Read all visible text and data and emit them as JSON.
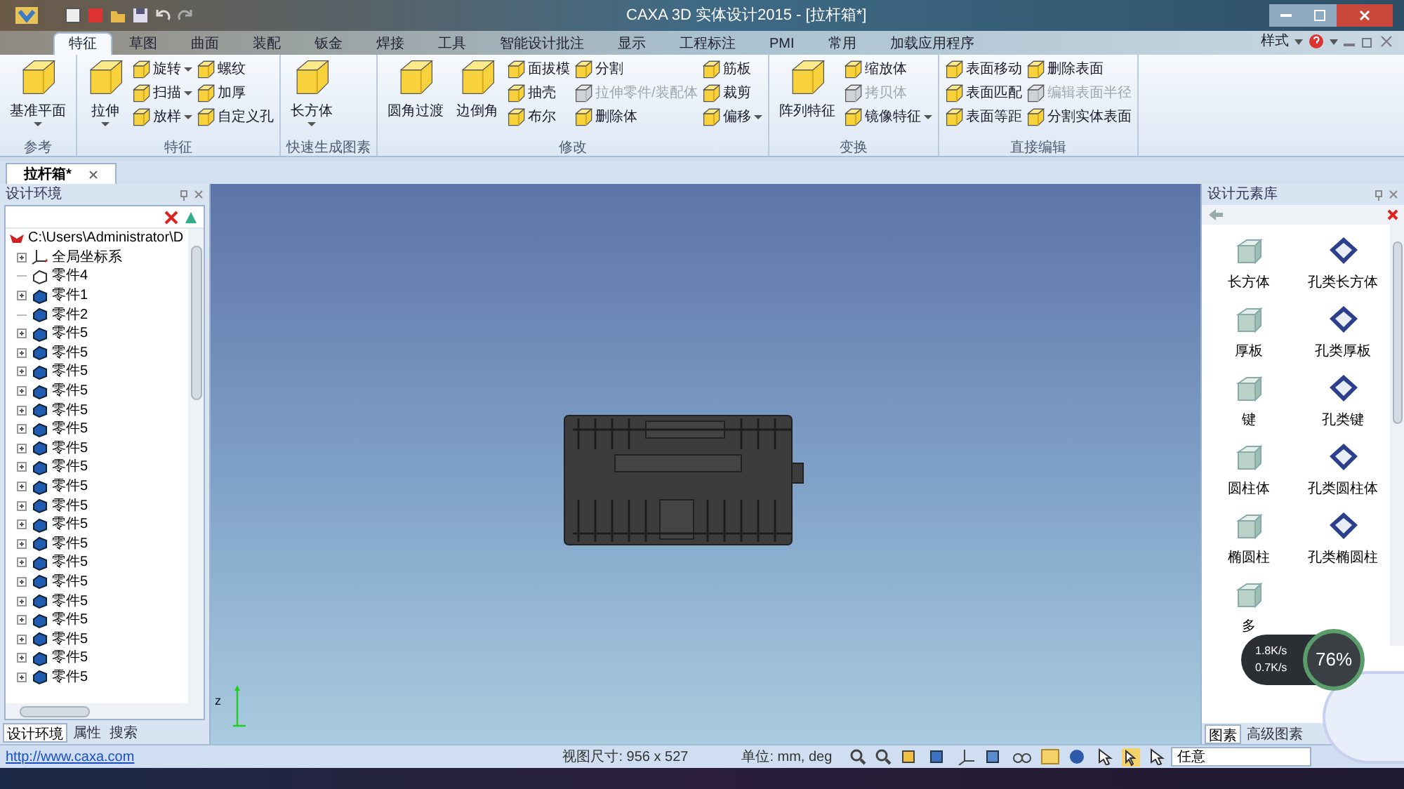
{
  "window": {
    "title": "CAXA 3D 实体设计2015 - [拉杆箱*]"
  },
  "ribbon_tabs": [
    {
      "label": "特征",
      "selected": true
    },
    {
      "label": "草图",
      "selected": false
    },
    {
      "label": "曲面",
      "selected": false
    },
    {
      "label": "装配",
      "selected": false
    },
    {
      "label": "钣金",
      "selected": false
    },
    {
      "label": "焊接",
      "selected": false
    },
    {
      "label": "工具",
      "selected": false
    },
    {
      "label": "智能设计批注",
      "selected": false
    },
    {
      "label": "显示",
      "selected": false
    },
    {
      "label": "工程标注",
      "selected": false
    },
    {
      "label": "PMI",
      "selected": false
    },
    {
      "label": "常用",
      "selected": false
    },
    {
      "label": "加载应用程序",
      "selected": false
    }
  ],
  "style_menu": "样式",
  "ribbon_groups": [
    {
      "label": "参考",
      "items": [
        {
          "label": "基准平面",
          "kind": "large",
          "dropdown": true,
          "disabled": false
        }
      ]
    },
    {
      "label": "特征",
      "items": [
        {
          "label": "拉伸",
          "kind": "large",
          "dropdown": true,
          "disabled": false
        },
        {
          "label": "旋转",
          "kind": "small",
          "dropdown": true,
          "disabled": false
        },
        {
          "label": "扫描",
          "kind": "small",
          "dropdown": true,
          "disabled": false
        },
        {
          "label": "放样",
          "kind": "small",
          "dropdown": true,
          "disabled": false
        },
        {
          "label": "螺纹",
          "kind": "small",
          "dropdown": false,
          "disabled": false
        },
        {
          "label": "加厚",
          "kind": "small",
          "dropdown": false,
          "disabled": false
        },
        {
          "label": "自定义孔",
          "kind": "small",
          "dropdown": false,
          "disabled": false
        }
      ]
    },
    {
      "label": "快速生成图素",
      "items": [
        {
          "label": "长方体",
          "kind": "large",
          "dropdown": true,
          "disabled": false
        }
      ]
    },
    {
      "label": "修改",
      "items": [
        {
          "label": "圆角过渡",
          "kind": "large",
          "dropdown": false,
          "disabled": false
        },
        {
          "label": "边倒角",
          "kind": "large",
          "dropdown": false,
          "disabled": false
        },
        {
          "label": "面拔模",
          "kind": "small",
          "dropdown": false,
          "disabled": false
        },
        {
          "label": "抽壳",
          "kind": "small",
          "dropdown": false,
          "disabled": false
        },
        {
          "label": "布尔",
          "kind": "small",
          "dropdown": false,
          "disabled": false
        },
        {
          "label": "分割",
          "kind": "small",
          "dropdown": false,
          "disabled": false
        },
        {
          "label": "拉伸零件/装配体",
          "kind": "small",
          "dropdown": false,
          "disabled": true
        },
        {
          "label": "删除体",
          "kind": "small",
          "dropdown": false,
          "disabled": false
        },
        {
          "label": "筋板",
          "kind": "small",
          "dropdown": false,
          "disabled": false
        },
        {
          "label": "裁剪",
          "kind": "small",
          "dropdown": false,
          "disabled": false
        },
        {
          "label": "偏移",
          "kind": "small",
          "dropdown": true,
          "disabled": false
        }
      ]
    },
    {
      "label": "变换",
      "items": [
        {
          "label": "阵列特征",
          "kind": "large",
          "dropdown": false,
          "disabled": false
        },
        {
          "label": "缩放体",
          "kind": "small",
          "dropdown": false,
          "disabled": false
        },
        {
          "label": "拷贝体",
          "kind": "small",
          "dropdown": false,
          "disabled": true
        },
        {
          "label": "镜像特征",
          "kind": "small",
          "dropdown": true,
          "disabled": false
        }
      ]
    },
    {
      "label": "直接编辑",
      "items": [
        {
          "label": "表面移动",
          "kind": "small",
          "dropdown": false,
          "disabled": false
        },
        {
          "label": "表面匹配",
          "kind": "small",
          "dropdown": false,
          "disabled": false
        },
        {
          "label": "表面等距",
          "kind": "small",
          "dropdown": false,
          "disabled": false
        },
        {
          "label": "删除表面",
          "kind": "small",
          "dropdown": false,
          "disabled": false
        },
        {
          "label": "编辑表面半径",
          "kind": "small",
          "dropdown": false,
          "disabled": true
        },
        {
          "label": "分割实体表面",
          "kind": "small",
          "dropdown": false,
          "disabled": false
        }
      ]
    }
  ],
  "document_tab": "拉杆箱*",
  "left_panel": {
    "title": "设计环境",
    "tree": {
      "label": "C:\\Users\\Administrator\\D",
      "children": [
        {
          "label": "全局坐标系",
          "kind": "axes",
          "expander": true
        },
        {
          "label": "零件4",
          "kind": "part_outline",
          "expander": false
        },
        {
          "label": "零件1",
          "kind": "part",
          "expander": true
        },
        {
          "label": "零件2",
          "kind": "part",
          "expander": false
        },
        {
          "label": "零件5",
          "kind": "part",
          "expander": true
        },
        {
          "label": "零件5",
          "kind": "part",
          "expander": true
        },
        {
          "label": "零件5",
          "kind": "part",
          "expander": true
        },
        {
          "label": "零件5",
          "kind": "part",
          "expander": true
        },
        {
          "label": "零件5",
          "kind": "part",
          "expander": true
        },
        {
          "label": "零件5",
          "kind": "part",
          "expander": true
        },
        {
          "label": "零件5",
          "kind": "part",
          "expander": true
        },
        {
          "label": "零件5",
          "kind": "part",
          "expander": true
        },
        {
          "label": "零件5",
          "kind": "part",
          "expander": true
        },
        {
          "label": "零件5",
          "kind": "part",
          "expander": true
        },
        {
          "label": "零件5",
          "kind": "part",
          "expander": true
        },
        {
          "label": "零件5",
          "kind": "part",
          "expander": true
        },
        {
          "label": "零件5",
          "kind": "part",
          "expander": true
        },
        {
          "label": "零件5",
          "kind": "part",
          "expander": true
        },
        {
          "label": "零件5",
          "kind": "part",
          "expander": true
        },
        {
          "label": "零件5",
          "kind": "part",
          "expander": true
        },
        {
          "label": "零件5",
          "kind": "part",
          "expander": true
        },
        {
          "label": "零件5",
          "kind": "part",
          "expander": true
        },
        {
          "label": "零件5",
          "kind": "part",
          "expander": true
        }
      ]
    },
    "tabs": [
      {
        "label": "设计环境",
        "selected": true
      },
      {
        "label": "属性",
        "selected": false
      },
      {
        "label": "搜索",
        "selected": false
      }
    ]
  },
  "viewport": {
    "axis_label": "z"
  },
  "right_panel": {
    "title": "设计元素库",
    "items": [
      {
        "label": "长方体",
        "kind": "solid"
      },
      {
        "label": "孔类长方体",
        "kind": "hole"
      },
      {
        "label": "厚板",
        "kind": "solid"
      },
      {
        "label": "孔类厚板",
        "kind": "hole"
      },
      {
        "label": "键",
        "kind": "solid"
      },
      {
        "label": "孔类键",
        "kind": "hole"
      },
      {
        "label": "圆柱体",
        "kind": "solid"
      },
      {
        "label": "孔类圆柱体",
        "kind": "hole"
      },
      {
        "label": "椭圆柱",
        "kind": "solid"
      },
      {
        "label": "孔类椭圆柱",
        "kind": "hole"
      },
      {
        "label": "多",
        "kind": "solid"
      }
    ],
    "tabs": [
      {
        "label": "图素",
        "selected": true
      },
      {
        "label": "高级图素",
        "selected": false
      }
    ]
  },
  "status_bar": {
    "link": "http://www.caxa.com",
    "view_size": "视图尺寸: 956 x 527",
    "units": "单位: mm, deg",
    "filter": "任意"
  },
  "speed_widget": {
    "upload": "1.8K/s",
    "download": "0.7K/s",
    "percent": "76%"
  }
}
